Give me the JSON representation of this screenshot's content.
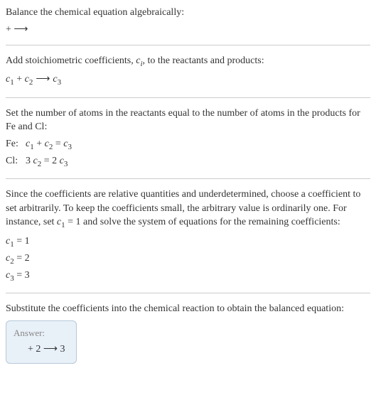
{
  "section1": {
    "title": "Balance the chemical equation algebraically:",
    "equation": " +  ⟶"
  },
  "section2": {
    "title_pre": "Add stoichiometric coefficients, ",
    "ci": "c",
    "ci_sub": "i",
    "title_post": ", to the reactants and products:",
    "eq_c1": "c",
    "eq_c1_sub": "1",
    "eq_plus": "  + ",
    "eq_c2": "c",
    "eq_c2_sub": "2",
    "eq_arrow": "   ⟶ ",
    "eq_c3": "c",
    "eq_c3_sub": "3"
  },
  "section3": {
    "title": "Set the number of atoms in the reactants equal to the number of atoms in the products for Fe and Cl:",
    "fe_label": "Fe:",
    "fe_c1": "c",
    "fe_c1_sub": "1",
    "fe_plus": " + ",
    "fe_c2": "c",
    "fe_c2_sub": "2",
    "fe_eq": " = ",
    "fe_c3": "c",
    "fe_c3_sub": "3",
    "cl_label": "Cl:",
    "cl_3": "3 ",
    "cl_c2": "c",
    "cl_c2_sub": "2",
    "cl_eq": " = 2 ",
    "cl_c3": "c",
    "cl_c3_sub": "3"
  },
  "section4": {
    "title_pre": "Since the coefficients are relative quantities and underdetermined, choose a coefficient to set arbitrarily. To keep the coefficients small, the arbitrary value is ordinarily one. For instance, set ",
    "c1": "c",
    "c1_sub": "1",
    "title_post": " = 1 and solve the system of equations for the remaining coefficients:",
    "r1_c": "c",
    "r1_sub": "1",
    "r1_val": " = 1",
    "r2_c": "c",
    "r2_sub": "2",
    "r2_val": " = 2",
    "r3_c": "c",
    "r3_sub": "3",
    "r3_val": " = 3"
  },
  "section5": {
    "title": "Substitute the coefficients into the chemical reaction to obtain the balanced equation:"
  },
  "answer": {
    "label": "Answer:",
    "equation": " + 2  ⟶ 3"
  }
}
